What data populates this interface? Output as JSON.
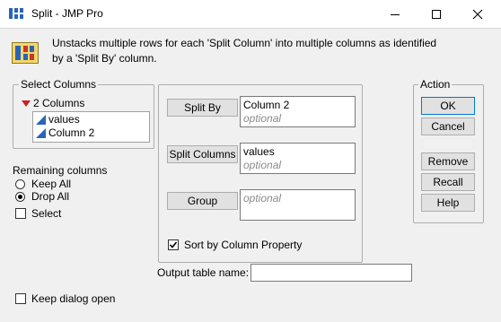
{
  "window": {
    "title": "Split - JMP Pro"
  },
  "icons": {
    "app": "jmp-split-icon",
    "minimize": "minimize-icon",
    "maximize": "maximize-icon",
    "close": "close-icon"
  },
  "description": "Unstacks multiple rows for each 'Split Column' into multiple columns as identified by a 'Split By' column.",
  "select_columns": {
    "legend": "Select Columns",
    "count_label": "2 Columns",
    "items": [
      "values",
      "Column 2"
    ]
  },
  "remaining": {
    "label": "Remaining columns",
    "keep_all": "Keep All",
    "drop_all": "Drop All",
    "selected": "Drop All",
    "select": "Select"
  },
  "roles": {
    "split_by": {
      "button": "Split By",
      "value": "Column 2",
      "placeholder": "optional"
    },
    "split_columns": {
      "button": "Split Columns",
      "value": "values",
      "placeholder": "optional"
    },
    "group": {
      "button": "Group",
      "value": "",
      "placeholder": "optional"
    },
    "sort_label": "Sort by Column Property",
    "sort_checked": true
  },
  "output": {
    "label": "Output table name:",
    "value": ""
  },
  "action": {
    "legend": "Action",
    "ok": "OK",
    "cancel": "Cancel",
    "remove": "Remove",
    "recall": "Recall",
    "help": "Help"
  },
  "keep_open": {
    "label": "Keep dialog open",
    "checked": false
  },
  "colors": {
    "accent": "#0078d7",
    "column_icon": "#2a64b8",
    "red_triangle": "#cc1f1f"
  }
}
